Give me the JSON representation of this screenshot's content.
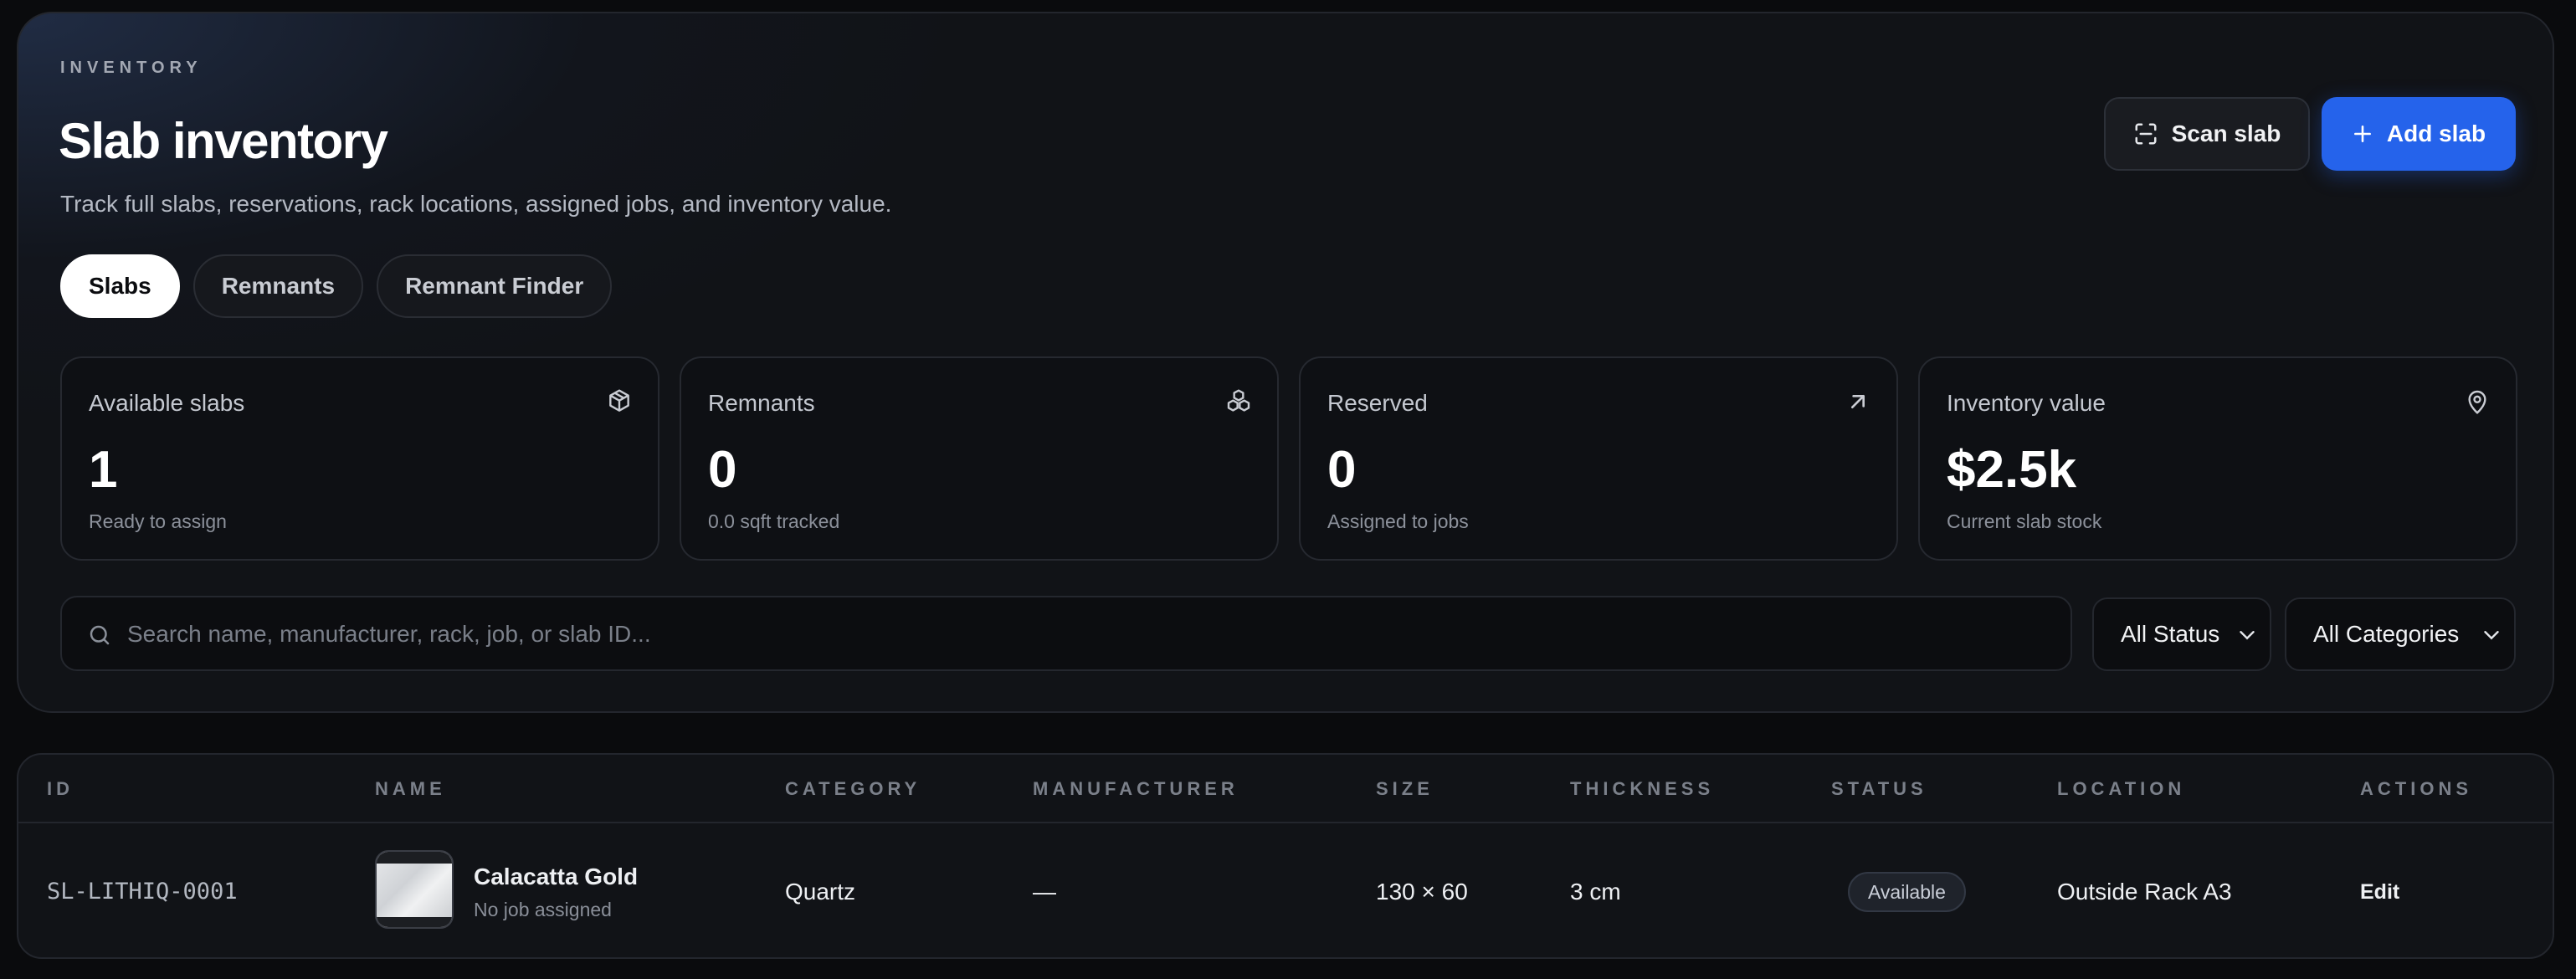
{
  "header": {
    "eyebrow": "INVENTORY",
    "title": "Slab inventory",
    "subtitle": "Track full slabs, reservations, rack locations, assigned jobs, and inventory value.",
    "scan_label": "Scan slab",
    "add_label": "Add slab"
  },
  "tabs": [
    {
      "label": "Slabs",
      "active": true
    },
    {
      "label": "Remnants",
      "active": false
    },
    {
      "label": "Remnant Finder",
      "active": false
    }
  ],
  "stats": [
    {
      "label": "Available slabs",
      "value": "1",
      "sub": "Ready to assign",
      "icon": "box-icon"
    },
    {
      "label": "Remnants",
      "value": "0",
      "sub": "0.0 sqft tracked",
      "icon": "cubes-icon"
    },
    {
      "label": "Reserved",
      "value": "0",
      "sub": "Assigned to jobs",
      "icon": "arrow-up-right-icon"
    },
    {
      "label": "Inventory value",
      "value": "$2.5k",
      "sub": "Current slab stock",
      "icon": "map-pin-icon"
    }
  ],
  "search": {
    "placeholder": "Search name, manufacturer, rack, job, or slab ID..."
  },
  "filters": {
    "status": "All Status",
    "category": "All Categories"
  },
  "table": {
    "headers": {
      "id": "ID",
      "name": "NAME",
      "category": "CATEGORY",
      "manufacturer": "MANUFACTURER",
      "size": "SIZE",
      "thickness": "THICKNESS",
      "status": "STATUS",
      "location": "LOCATION",
      "actions": "ACTIONS"
    },
    "rows": [
      {
        "id": "SL-LITHIQ-0001",
        "name": "Calacatta Gold",
        "job": "No job assigned",
        "category": "Quartz",
        "manufacturer": "—",
        "size": "130 × 60",
        "thickness": "3 cm",
        "status": "Available",
        "location": "Outside Rack A3",
        "action": "Edit"
      }
    ]
  },
  "colors": {
    "accent": "#2563eb",
    "background": "#0a0b0d",
    "panel": "#111317"
  }
}
